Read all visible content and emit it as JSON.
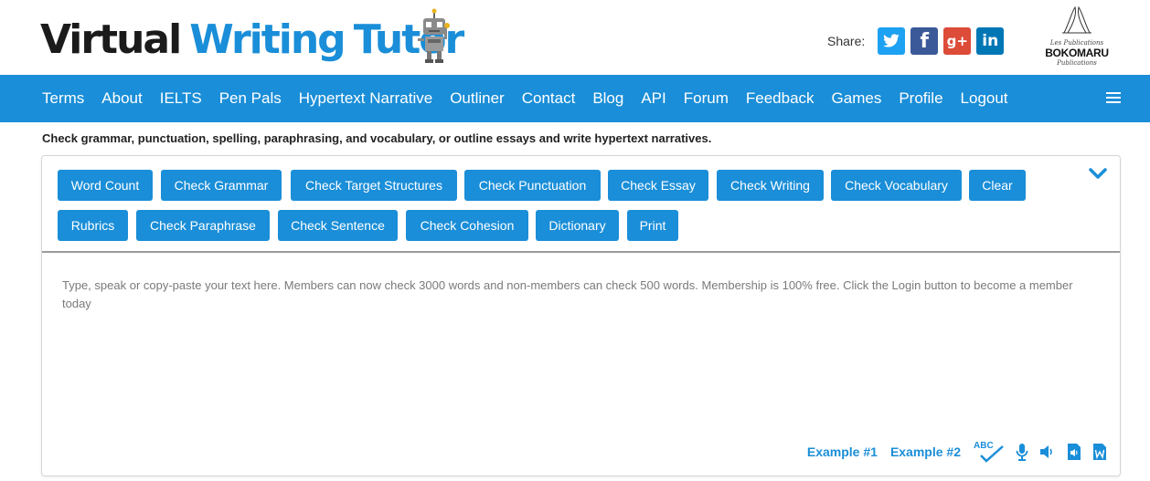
{
  "header": {
    "logo_word_1": "Virtual",
    "logo_word_2": "Writing",
    "logo_word_3": "Tutor",
    "share_label": "Share:",
    "publisher_line_1": "Les Publications",
    "publisher_line_2": "BOKOMARU",
    "publisher_line_3": "Publications"
  },
  "nav": {
    "items": [
      "Terms",
      "About",
      "IELTS",
      "Pen Pals",
      "Hypertext Narrative",
      "Outliner",
      "Contact",
      "Blog",
      "API",
      "Forum",
      "Feedback",
      "Games",
      "Profile",
      "Logout"
    ]
  },
  "tagline": "Check grammar, punctuation, spelling, paraphrasing, and vocabulary, or outline essays and write hypertext narratives.",
  "toolbar": {
    "row1": [
      "Word Count",
      "Check Grammar",
      "Check Target Structures",
      "Check Punctuation",
      "Check Essay",
      "Check Writing",
      "Check Vocabulary",
      "Clear"
    ],
    "row2": [
      "Rubrics",
      "Check Paraphrase",
      "Check Sentence",
      "Check Cohesion",
      "Dictionary",
      "Print"
    ]
  },
  "editor": {
    "placeholder": "Type, speak or copy-paste your text here. Members can now check 3000 words and non-members can check 500 words. Membership is 100% free. Click the Login button to become a member today"
  },
  "bottom": {
    "example1": "Example #1",
    "example2": "Example #2",
    "spellcheck_label": "ABC"
  },
  "colors": {
    "brand_blue": "#1a8ed8",
    "twitter": "#1da1f2",
    "facebook": "#3b5998",
    "google_plus": "#dd4b39",
    "linkedin": "#0077b5"
  },
  "icons": [
    "robot-mascot-icon",
    "twitter-icon",
    "facebook-icon",
    "google-plus-icon",
    "linkedin-icon",
    "hamburger-menu-icon",
    "chevron-down-icon",
    "spellcheck-icon",
    "microphone-icon",
    "speaker-icon",
    "audio-file-icon",
    "word-document-icon"
  ]
}
